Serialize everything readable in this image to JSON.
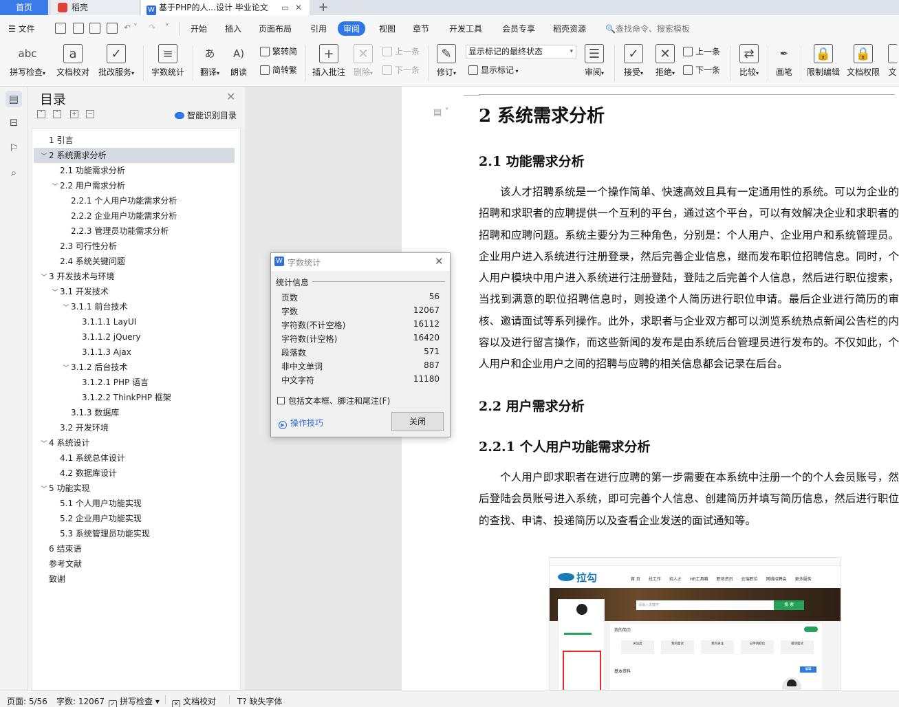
{
  "tabs": {
    "home": "首页",
    "daoke": "稻壳",
    "document": "基于PHP的人...设计 毕业论文"
  },
  "menu": {
    "file": "文件",
    "items": [
      "开始",
      "插入",
      "页面布局",
      "引用",
      "审阅",
      "视图",
      "章节",
      "开发工具",
      "会员专享",
      "稻壳资源"
    ],
    "active": "审阅",
    "search_placeholder": "查找命令、搜索模板"
  },
  "ribbon": {
    "spellcheck": "拼写检查",
    "doc_proof": "文档校对",
    "batch_service": "批改服务",
    "word_count": "字数统计",
    "translate": "翻译",
    "read_aloud": "朗读",
    "trad_conv": "繁转简",
    "simp_conv": "简转繁",
    "insert_comment": "插入批注",
    "delete": "删除",
    "prev_comment": "上一条",
    "next_comment": "下一条",
    "track": "修订",
    "markup_state": "显示标记的最终状态",
    "show_markup": "显示标记",
    "review": "审阅",
    "accept": "接受",
    "reject": "拒绝",
    "prev": "上一条",
    "next": "下一条",
    "compare": "比较",
    "pen": "画笔",
    "restrict": "限制编辑",
    "doc_rights": "文档权限",
    "more": "文"
  },
  "toc": {
    "title": "目录",
    "smart": "智能识别目录",
    "items": [
      {
        "label": "1 引言",
        "level": 1,
        "caret": ""
      },
      {
        "label": "2 系统需求分析",
        "level": 1,
        "caret": "v",
        "selected": true
      },
      {
        "label": "2.1 功能需求分析",
        "level": 2,
        "caret": ""
      },
      {
        "label": "2.2 用户需求分析",
        "level": 2,
        "caret": "v"
      },
      {
        "label": "2.2.1 个人用户功能需求分析",
        "level": 3,
        "caret": ""
      },
      {
        "label": "2.2.2 企业用户功能需求分析",
        "level": 3,
        "caret": ""
      },
      {
        "label": "2.2.3 管理员功能需求分析",
        "level": 3,
        "caret": ""
      },
      {
        "label": "2.3 可行性分析",
        "level": 2,
        "caret": ""
      },
      {
        "label": "2.4 系统关键问题",
        "level": 2,
        "caret": ""
      },
      {
        "label": "3 开发技术与环境",
        "level": 1,
        "caret": "v"
      },
      {
        "label": "3.1 开发技术",
        "level": 2,
        "caret": "v"
      },
      {
        "label": "3.1.1 前台技术",
        "level": 3,
        "caret": "v"
      },
      {
        "label": "3.1.1.1 LayUI",
        "level": 4,
        "caret": ""
      },
      {
        "label": "3.1.1.2 jQuery",
        "level": 4,
        "caret": ""
      },
      {
        "label": "3.1.1.3 Ajax",
        "level": 4,
        "caret": ""
      },
      {
        "label": "3.1.2 后台技术",
        "level": 3,
        "caret": "v"
      },
      {
        "label": "3.1.2.1 PHP 语言",
        "level": 4,
        "caret": ""
      },
      {
        "label": "3.1.2.2 ThinkPHP 框架",
        "level": 4,
        "caret": ""
      },
      {
        "label": "3.1.3 数据库",
        "level": 3,
        "caret": ""
      },
      {
        "label": "3.2 开发环境",
        "level": 2,
        "caret": ""
      },
      {
        "label": "4 系统设计",
        "level": 1,
        "caret": "v"
      },
      {
        "label": "4.1 系统总体设计",
        "level": 2,
        "caret": ""
      },
      {
        "label": "4.2 数据库设计",
        "level": 2,
        "caret": ""
      },
      {
        "label": "5 功能实现",
        "level": 1,
        "caret": "v"
      },
      {
        "label": "5.1 个人用户功能实现",
        "level": 2,
        "caret": ""
      },
      {
        "label": "5.2 企业用户功能实现",
        "level": 2,
        "caret": ""
      },
      {
        "label": "5.3 系统管理员功能实现",
        "level": 2,
        "caret": ""
      },
      {
        "label": "6 结束语",
        "level": 1,
        "caret": ""
      },
      {
        "label": "参考文献",
        "level": 1,
        "caret": ""
      },
      {
        "label": "致谢",
        "level": 1,
        "caret": ""
      }
    ]
  },
  "document": {
    "h1": "2 系统需求分析",
    "h2_1": "2.1 功能需求分析",
    "p1": "该人才招聘系统是一个操作简单、快速高效且具有一定通用性的系统。可以为企业的招聘和求职者的应聘提供一个互利的平台，通过这个平台，可以有效解决企业和求职者的招聘和应聘问题。系统主要分为三种角色，分别是：个人用户、企业用户和系统管理员。企业用户进入系统进行注册登录，然后完善企业信息，继而发布职位招聘信息。同时，个人用户模块中用户进入系统进行注册登陆，登陆之后完善个人信息，然后进行职位搜索，当找到满意的职位招聘信息时，则投递个人简历进行职位申请。最后企业进行简历的审核、邀请面试等系列操作。此外，求职者与企业双方都可以浏览系统热点新闻公告栏的内容以及进行留言操作，而这些新闻的发布是由系统后台管理员进行发布的。不仅如此，个人用户和企业用户之间的招聘与应聘的相关信息都会记录在后台。",
    "h2_2": "2.2 用户需求分析",
    "h3_1": "2.2.1 个人用户功能需求分析",
    "p2": "个人用户即求职者在进行应聘的第一步需要在本系统中注册一个的个人会员账号，然后登陆会员账号进入系统，即可完善个人信息、创建简历并填写简历信息，然后进行职位的查找、申请、投递简历以及查看企业发送的面试通知等。",
    "shot": {
      "logo": "拉勾",
      "nav": [
        "首 页",
        "找工作",
        "招人才",
        "HR工具箱",
        "职场资讯",
        "云端职位",
        "网络招聘会",
        "更多服务"
      ],
      "search_placeholder": "请输入关键字",
      "search_btn": "搜 索",
      "resume": "我的简历",
      "base_info": "基本资料",
      "edit": "编辑",
      "stats": [
        "关注度",
        "我的面试",
        "我的关注",
        "已申请职位",
        "邀请面试"
      ]
    }
  },
  "dialog": {
    "title": "字数统计",
    "group": "统计信息",
    "rows": [
      {
        "label": "页数",
        "value": "56"
      },
      {
        "label": "字数",
        "value": "12067"
      },
      {
        "label": "字符数(不计空格)",
        "value": "16112"
      },
      {
        "label": "字符数(计空格)",
        "value": "16420"
      },
      {
        "label": "段落数",
        "value": "571"
      },
      {
        "label": "非中文单词",
        "value": "887"
      },
      {
        "label": "中文字符",
        "value": "11180"
      }
    ],
    "checkbox": "包括文本框、脚注和尾注(F)",
    "tips": "操作技巧",
    "close": "关闭"
  },
  "status": {
    "page": "页面: 5/56",
    "words": "字数: 12067",
    "spell": "拼写检查",
    "proof": "文档校对",
    "missing_font": "缺失字体"
  }
}
